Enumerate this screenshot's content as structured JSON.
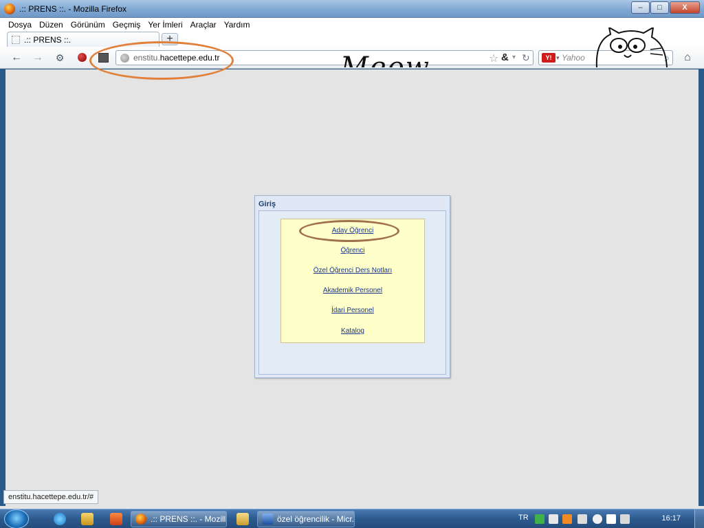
{
  "window": {
    "title": ".:: PRENS ::. - Mozilla Firefox",
    "controls": {
      "minimize": "–",
      "maximize": "□",
      "close": "X"
    }
  },
  "menubar": {
    "items": [
      "Dosya",
      "Düzen",
      "Görünüm",
      "Geçmiş",
      "Yer İmleri",
      "Araçlar",
      "Yardım"
    ]
  },
  "tabs": [
    {
      "label": ".:: PRENS ::."
    }
  ],
  "new_tab_label": "+",
  "navbar": {
    "url_prefix": "enstitu.",
    "url_domain": "hacettepe.edu.tr",
    "search_placeholder": "Yahoo",
    "search_engine_badge": "Y!"
  },
  "persona_text": "Meow",
  "panel": {
    "title": "Giriş",
    "links": [
      "Aday Öğrenci",
      "Öğrenci",
      "Özel Öğrenci Ders Notları",
      "Akademik Personel",
      "İdari Personel",
      "Katalog"
    ]
  },
  "status_url": "enstitu.hacettepe.edu.tr/#",
  "taskbar": {
    "tasks": [
      {
        "label": ".:: PRENS ::. - Mozilla ..."
      },
      {
        "label": "özel öğrencilik - Micr..."
      }
    ],
    "tray": {
      "language": "TR",
      "clock": "16:17"
    }
  },
  "colors": {
    "link": "#1a3590",
    "panel_title": "#1f3f73",
    "menu_box_bg": "#ffffc9",
    "annotation_orange": "#e0803a",
    "annotation_brown": "#a0704a"
  }
}
